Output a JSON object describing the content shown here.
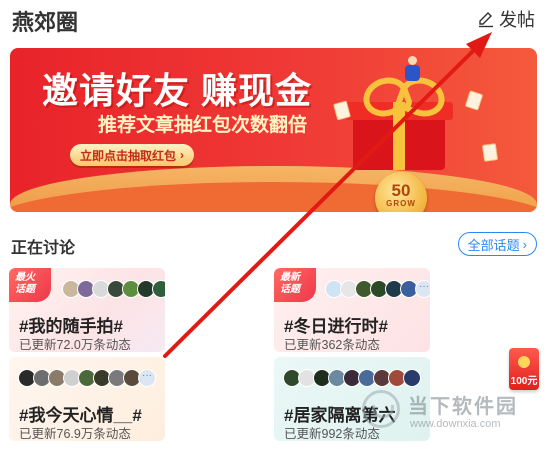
{
  "header": {
    "title": "燕郊圈",
    "post_label": "发帖"
  },
  "banner": {
    "headline": "邀请好友 赚现金",
    "subline": "推荐文章抽红包次数翻倍",
    "cta": "立即点击抽取红包",
    "coin_number": "50",
    "coin_word": "GROW"
  },
  "section": {
    "title": "正在讨论",
    "all_topics": "全部话题"
  },
  "topics": [
    {
      "badge": "最火\n话题",
      "name": "#我的随手拍#",
      "count": "已更新72.0万条动态"
    },
    {
      "badge": "最新\n话题",
      "name": "#冬日进行时#",
      "count": "已更新362条动态"
    },
    {
      "badge": "",
      "name": "#我今天心情__#",
      "count": "已更新76.9万条动态"
    },
    {
      "badge": "",
      "name": "#居家隔离第六",
      "count": "已更新992条动态"
    }
  ],
  "floating_redpack": {
    "amount": "100元"
  },
  "watermark": {
    "name": "当下软件园",
    "url": "www.downxia.com"
  },
  "colors": {
    "accent": "#2e86f5",
    "banner_red": "#e8232a",
    "annotation_arrow": "#e11b14"
  }
}
